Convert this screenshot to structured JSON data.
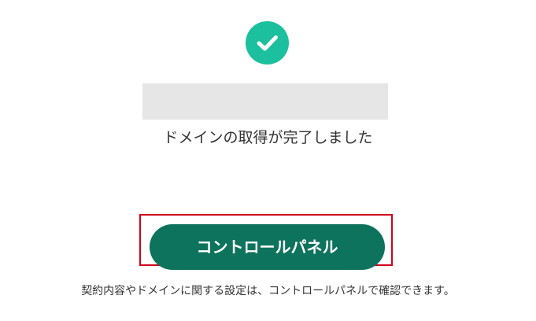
{
  "status": {
    "icon": "check-circle-icon",
    "icon_color": "#1cbf9e",
    "message": "ドメインの取得が完了しました"
  },
  "actions": {
    "control_panel_label": "コントロールパネル",
    "button_color": "#0e735c",
    "highlight_color": "#d0021b"
  },
  "footer": {
    "note": "契約内容やドメインに関する設定は、コントロールパネルで確認できます。"
  }
}
